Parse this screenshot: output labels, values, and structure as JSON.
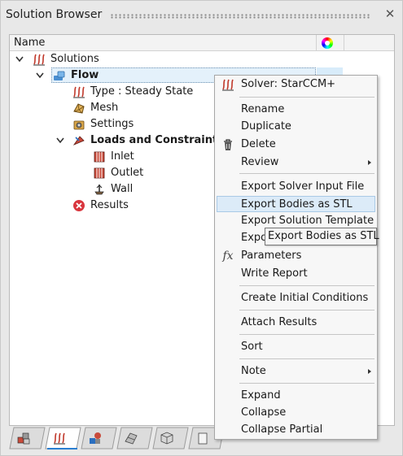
{
  "window": {
    "title": "Solution Browser"
  },
  "columns": {
    "name": "Name"
  },
  "tree": {
    "solutions": "Solutions",
    "flow": "Flow",
    "type": "Type : Steady State",
    "mesh": "Mesh",
    "settings": "Settings",
    "loads": "Loads and Constraints",
    "inlet": "Inlet",
    "outlet": "Outlet",
    "wall": "Wall",
    "results": "Results"
  },
  "menu": {
    "solver": "Solver: StarCCM+",
    "rename": "Rename",
    "duplicate": "Duplicate",
    "delete": "Delete",
    "review": "Review",
    "export_input": "Export Solver Input File",
    "export_stl": "Export Bodies as STL",
    "export_template": "Export Solution Template",
    "export_partial": "Expo",
    "parameters": "Parameters",
    "write_report": "Write Report",
    "create_ic": "Create Initial Conditions",
    "attach_results": "Attach Results",
    "sort": "Sort",
    "note": "Note",
    "expand": "Expand",
    "collapse": "Collapse",
    "collapse_partial": "Collapse Partial"
  },
  "tooltip": {
    "text": "Export Bodies as STL"
  },
  "icons": {
    "fx_glyph": "fx",
    "submenu_arrow": "›",
    "close": "✕"
  },
  "colors": {
    "selection": "#e4f1fb",
    "menu_hover": "#dcebf8",
    "solver_red": "#c0392b",
    "results_red": "#d9363e"
  }
}
